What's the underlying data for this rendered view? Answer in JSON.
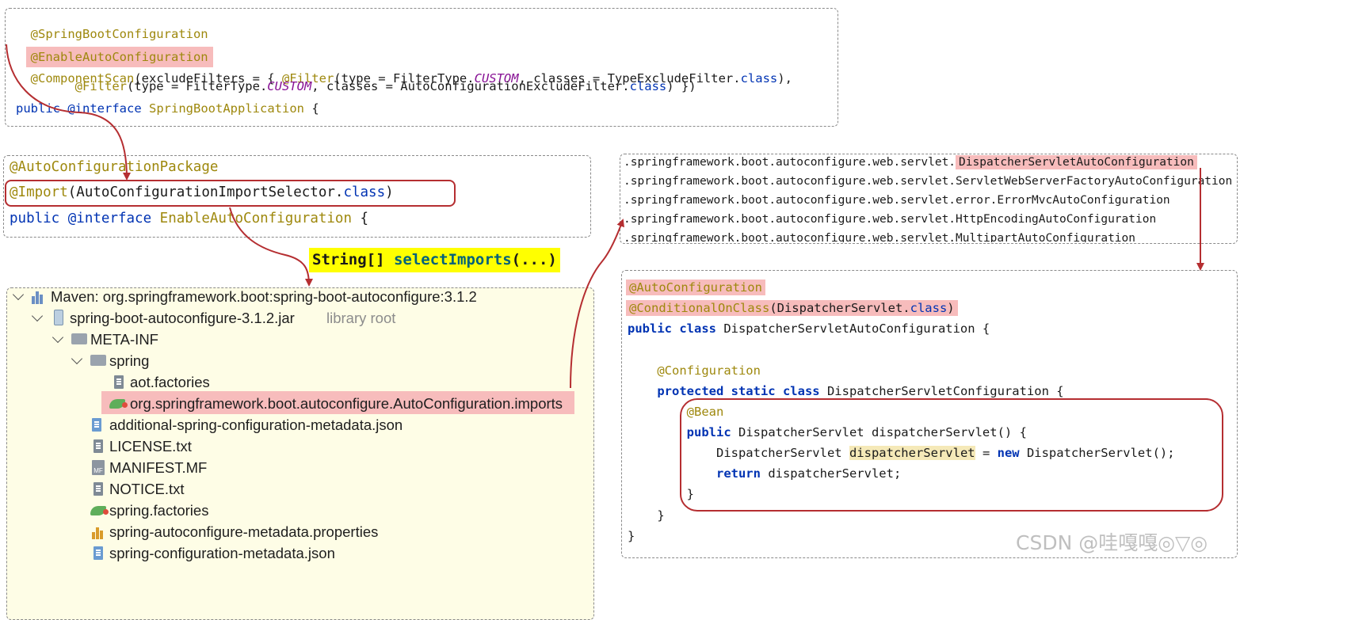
{
  "box1": {
    "lines": [
      "@SpringBootConfiguration",
      "@EnableAutoConfiguration",
      "@ComponentScan(excludeFilters = { @Filter(type = FilterType.CUSTOM, classes = TypeExcludeFilter.class),",
      "        @Filter(type = FilterType.CUSTOM, classes = AutoConfigurationExcludeFilter.class) })",
      "public @interface SpringBootApplication {"
    ]
  },
  "box2": {
    "lines": [
      "@AutoConfigurationPackage",
      "@Import(AutoConfigurationImportSelector.class)",
      "public @interface EnableAutoConfiguration {"
    ]
  },
  "select_label": "String[] selectImports(...)",
  "tree": {
    "rows": [
      {
        "text": "Maven: org.springframework.boot:spring-boot-autoconfigure:3.1.2",
        "icon": "library-icon",
        "arrow": "expanded"
      },
      {
        "text": "spring-boot-autoconfigure-3.1.2.jar",
        "suffix": "library root",
        "icon": "jar-icon",
        "arrow": "expanded"
      },
      {
        "text": "META-INF",
        "icon": "folder-icon",
        "arrow": "expanded"
      },
      {
        "text": "spring",
        "icon": "folder-icon",
        "arrow": "expanded"
      },
      {
        "text": "aot.factories",
        "icon": "file-icon"
      },
      {
        "text": "org.springframework.boot.autoconfigure.AutoConfiguration.imports",
        "icon": "spring-leaf-icon",
        "highlight": true
      },
      {
        "text": "additional-spring-configuration-metadata.json",
        "icon": "json-icon"
      },
      {
        "text": "LICENSE.txt",
        "icon": "text-file-icon"
      },
      {
        "text": "MANIFEST.MF",
        "icon": "manifest-icon"
      },
      {
        "text": "NOTICE.txt",
        "icon": "text-file-icon"
      },
      {
        "text": "spring.factories",
        "icon": "spring-leaf-icon"
      },
      {
        "text": "spring-autoconfigure-metadata.properties",
        "icon": "properties-icon"
      },
      {
        "text": "spring-configuration-metadata.json",
        "icon": "json-icon"
      }
    ]
  },
  "imports": {
    "prefix": ".springframework.boot.autoconfigure.web.servlet.",
    "lines": [
      ".springframework.boot.autoconfigure.web.servlet.DispatcherServletAutoConfiguration",
      ".springframework.boot.autoconfigure.web.servlet.ServletWebServerFactoryAutoConfiguration",
      ".springframework.boot.autoconfigure.web.servlet.error.ErrorMvcAutoConfiguration",
      ".springframework.boot.autoconfigure.web.servlet.HttpEncodingAutoConfiguration",
      ".springframework.boot.autoconfigure.web.servlet.MultipartAutoConfiguration"
    ],
    "highlight": "DispatcherServletAutoConfiguration"
  },
  "box4": {
    "lines": [
      "@AutoConfiguration",
      "@ConditionalOnClass(DispatcherServlet.class)",
      "public class DispatcherServletAutoConfiguration {",
      "",
      "    @Configuration",
      "    protected static class DispatcherServletConfiguration {",
      "        @Bean",
      "        public DispatcherServlet dispatcherServlet() {",
      "            DispatcherServlet dispatcherServlet = new DispatcherServlet();",
      "            return dispatcherServlet;",
      "        }",
      "    }",
      "}"
    ]
  },
  "watermark": "CSDN @哇嘎嘎◎▽◎",
  "colors": {
    "annotation": "#9e880d",
    "keyword": "#0033b3",
    "highlight_pink": "#f7bcbc",
    "arrow_red": "#b52e31",
    "select_yellow": "#ffff00",
    "tree_bg": "#fefde6"
  }
}
